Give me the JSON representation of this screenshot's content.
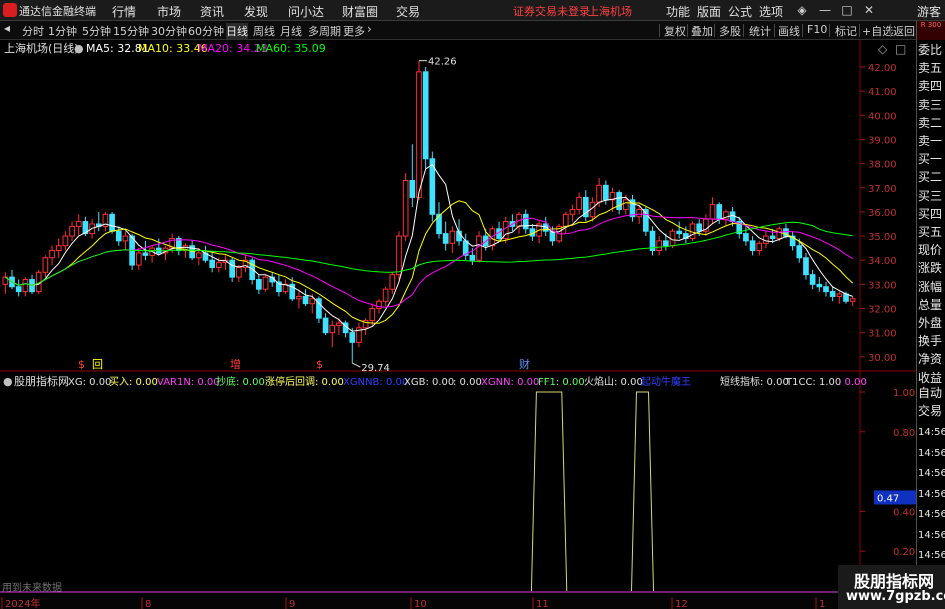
{
  "menubar": {
    "app_title": "通达信金融终端",
    "menus": [
      "行情",
      "市场",
      "资讯",
      "发现",
      "问小达",
      "财富圈",
      "交易"
    ],
    "warning": "证券交易未登录",
    "market": "上海机场",
    "right_menus": [
      "功能",
      "版面",
      "公式",
      "选项"
    ],
    "guest": "游客"
  },
  "toolbar": {
    "periods": [
      "分时",
      "1分钟",
      "5分钟",
      "15分钟",
      "30分钟",
      "60分钟",
      "日线",
      "周线",
      "月线",
      "多周期",
      "更多"
    ],
    "active_period": "日线",
    "tools": [
      "复权",
      "叠加",
      "多股",
      "统计",
      "画线",
      "F10",
      "标记",
      "+自选",
      "返回"
    ]
  },
  "corner_badge": "R 300",
  "main_chart": {
    "title": "上海机场(日线)",
    "ma": [
      {
        "label": "MA5: 32.81",
        "color": "#ffffff"
      },
      {
        "label": "MA10: 33.46",
        "color": "#ffff00"
      },
      {
        "label": "MA20: 34.23",
        "color": "#ff00ff"
      },
      {
        "label": "MA60: 35.09",
        "color": "#00ff00"
      }
    ],
    "y_ticks": [
      "42.00",
      "41.00",
      "40.00",
      "39.00",
      "38.00",
      "37.00",
      "36.00",
      "35.00",
      "34.00",
      "33.00",
      "32.00",
      "31.00",
      "30.00"
    ],
    "high_label": "42.26",
    "low_label": "29.74",
    "event_markers": [
      {
        "text": "$",
        "color": "#ff4040"
      },
      {
        "text": "回",
        "color": "#ffff00"
      },
      {
        "text": "增",
        "color": "#ff4040"
      },
      {
        "text": "$",
        "color": "#ff4040"
      },
      {
        "text": "财",
        "color": "#6090ff"
      }
    ]
  },
  "indicator": {
    "name": "股朋指标网",
    "items": [
      {
        "text": "XG: 0.00",
        "color": "#e0e0e0"
      },
      {
        "text": "买入: 0.00",
        "color": "#ffff60"
      },
      {
        "text": "VAR1N: 0.00",
        "color": "#ff40ff"
      },
      {
        "text": "抄底: 0.00",
        "color": "#60ff60"
      },
      {
        "text": "涨停后回调: 0.00",
        "color": "#ffff60"
      },
      {
        "text": "XGNNB: 0.00",
        "color": "#3040ff"
      },
      {
        "text": "XGB: 0.00",
        "color": "#e0e0e0"
      },
      {
        "text": ": 0.00",
        "color": "#e0e0e0"
      },
      {
        "text": "XGNN: 0.00",
        "color": "#ff40ff"
      },
      {
        "text": "FF1: 0.00",
        "color": "#60ff60"
      },
      {
        "text": "火焰山: 0.00",
        "color": "#e0e0e0"
      },
      {
        "text": "起动牛魔王",
        "color": "#3040ff"
      },
      {
        "text": "短线指标: 0.00",
        "color": "#e0e0e0"
      },
      {
        "text": "T1CC: 1.00",
        "color": "#e0e0e0"
      },
      {
        "text": ": 0.00",
        "color": "#ff40ff"
      }
    ],
    "y_ticks": [
      "1.00",
      "0.80",
      "0.47",
      "0.40",
      "0.20"
    ],
    "future_note": "用到未来数据"
  },
  "x_axis": [
    "2024年",
    "8",
    "9",
    "10",
    "11",
    "12",
    "1"
  ],
  "side_panel": {
    "tags": [
      "委比",
      "卖五",
      "卖四",
      "卖三",
      "卖二",
      "卖一",
      "买一",
      "买二",
      "买三",
      "买四",
      "买五",
      "现价",
      "涨跌",
      "涨幅",
      "总量",
      "外盘",
      "换手",
      "净资",
      "收益",
      "自动",
      "交易",
      "14:56",
      "14:56",
      "14:56",
      "14:56",
      "14:56",
      "14:56",
      "14:56",
      "14:56",
      "14:56"
    ]
  },
  "watermark": {
    "line1": "股朋指标网",
    "line2": "www.7gpzb.com"
  },
  "colors": {
    "up": "#ff3030",
    "down": "#40e0ff",
    "ma5": "#ffffff",
    "ma10": "#ffff00",
    "ma20": "#ff00ff",
    "ma60": "#00ff00",
    "sig_yellow": "#d8d870",
    "sig_magenta": "#e040e0",
    "grid": "#8b0000"
  },
  "candles": [
    [
      33.0,
      33.5,
      32.6,
      33.3
    ],
    [
      33.3,
      33.6,
      32.8,
      32.9
    ],
    [
      32.9,
      33.2,
      32.5,
      32.7
    ],
    [
      32.7,
      33.3,
      32.5,
      33.2
    ],
    [
      33.2,
      33.4,
      32.6,
      32.7
    ],
    [
      32.7,
      33.6,
      32.6,
      33.5
    ],
    [
      33.5,
      34.2,
      33.3,
      34.1
    ],
    [
      34.1,
      34.6,
      33.8,
      34.4
    ],
    [
      34.4,
      34.9,
      34.1,
      34.6
    ],
    [
      34.6,
      35.2,
      34.4,
      35.0
    ],
    [
      35.0,
      35.6,
      34.8,
      35.4
    ],
    [
      35.4,
      35.9,
      35.0,
      35.6
    ],
    [
      35.6,
      35.8,
      35.0,
      35.1
    ],
    [
      35.1,
      35.7,
      34.9,
      35.5
    ],
    [
      35.5,
      36.0,
      35.2,
      35.4
    ],
    [
      35.4,
      36.0,
      35.2,
      35.9
    ],
    [
      35.9,
      36.0,
      35.1,
      35.2
    ],
    [
      35.2,
      35.4,
      34.6,
      34.8
    ],
    [
      34.8,
      35.2,
      34.4,
      35.0
    ],
    [
      35.0,
      35.1,
      33.6,
      33.8
    ],
    [
      33.8,
      34.5,
      33.6,
      34.3
    ],
    [
      34.3,
      34.8,
      34.0,
      34.2
    ],
    [
      34.2,
      34.6,
      33.9,
      34.5
    ],
    [
      34.5,
      34.9,
      34.2,
      34.3
    ],
    [
      34.3,
      34.6,
      34.0,
      34.5
    ],
    [
      34.5,
      35.1,
      34.3,
      34.9
    ],
    [
      34.9,
      35.0,
      34.2,
      34.4
    ],
    [
      34.4,
      34.7,
      34.1,
      34.6
    ],
    [
      34.6,
      34.8,
      34.0,
      34.1
    ],
    [
      34.1,
      34.5,
      33.8,
      34.3
    ],
    [
      34.3,
      34.6,
      33.9,
      34.0
    ],
    [
      34.0,
      34.4,
      33.5,
      33.7
    ],
    [
      33.7,
      34.1,
      33.5,
      33.9
    ],
    [
      33.9,
      34.2,
      33.6,
      34.0
    ],
    [
      34.0,
      34.1,
      33.1,
      33.3
    ],
    [
      33.3,
      33.8,
      33.1,
      33.7
    ],
    [
      33.7,
      34.2,
      33.5,
      34.0
    ],
    [
      34.0,
      34.1,
      33.0,
      33.2
    ],
    [
      33.2,
      33.4,
      32.6,
      32.8
    ],
    [
      32.8,
      33.4,
      32.7,
      33.3
    ],
    [
      33.3,
      33.5,
      32.9,
      33.1
    ],
    [
      33.1,
      33.4,
      32.5,
      32.7
    ],
    [
      32.7,
      33.2,
      32.6,
      33.0
    ],
    [
      33.0,
      33.3,
      32.3,
      32.4
    ],
    [
      32.4,
      32.7,
      32.0,
      32.5
    ],
    [
      32.5,
      32.8,
      32.1,
      32.2
    ],
    [
      32.2,
      32.6,
      31.8,
      32.4
    ],
    [
      32.4,
      32.5,
      31.4,
      31.6
    ],
    [
      31.6,
      31.8,
      30.9,
      31.0
    ],
    [
      31.0,
      31.5,
      30.4,
      31.3
    ],
    [
      31.3,
      31.6,
      30.9,
      31.4
    ],
    [
      31.4,
      31.5,
      30.8,
      31.0
    ],
    [
      31.0,
      31.2,
      29.74,
      30.6
    ],
    [
      30.6,
      31.4,
      30.4,
      31.2
    ],
    [
      31.2,
      31.6,
      30.9,
      31.5
    ],
    [
      31.5,
      32.2,
      31.3,
      32.0
    ],
    [
      32.0,
      32.4,
      31.8,
      32.3
    ],
    [
      32.3,
      32.9,
      32.1,
      32.8
    ],
    [
      32.8,
      33.5,
      32.6,
      33.4
    ],
    [
      33.4,
      35.2,
      33.2,
      35.0
    ],
    [
      35.0,
      37.6,
      34.8,
      37.3
    ],
    [
      37.3,
      38.8,
      36.2,
      36.6
    ],
    [
      36.6,
      42.26,
      36.5,
      41.8
    ],
    [
      41.8,
      42.0,
      37.8,
      38.2
    ],
    [
      38.2,
      38.5,
      35.6,
      35.9
    ],
    [
      35.9,
      36.4,
      34.9,
      35.1
    ],
    [
      35.1,
      35.6,
      34.4,
      34.7
    ],
    [
      34.7,
      35.4,
      34.3,
      35.2
    ],
    [
      35.2,
      35.7,
      34.6,
      34.8
    ],
    [
      34.8,
      35.1,
      34.0,
      34.2
    ],
    [
      34.2,
      34.5,
      33.8,
      34.0
    ],
    [
      34.0,
      35.2,
      33.9,
      35.0
    ],
    [
      35.0,
      35.3,
      34.4,
      34.6
    ],
    [
      34.6,
      35.4,
      34.4,
      35.3
    ],
    [
      35.3,
      35.6,
      34.8,
      34.9
    ],
    [
      34.9,
      35.8,
      34.7,
      35.6
    ],
    [
      35.6,
      35.9,
      35.2,
      35.4
    ],
    [
      35.4,
      36.0,
      35.1,
      35.9
    ],
    [
      35.9,
      36.1,
      35.1,
      35.3
    ],
    [
      35.3,
      35.5,
      34.8,
      35.0
    ],
    [
      35.0,
      35.6,
      34.7,
      35.5
    ],
    [
      35.5,
      35.8,
      35.0,
      35.2
    ],
    [
      35.2,
      35.4,
      34.6,
      34.8
    ],
    [
      34.8,
      35.5,
      34.7,
      35.4
    ],
    [
      35.4,
      36.0,
      35.1,
      35.9
    ],
    [
      35.9,
      36.3,
      35.6,
      36.1
    ],
    [
      36.1,
      36.8,
      35.9,
      36.6
    ],
    [
      36.6,
      36.9,
      35.6,
      35.8
    ],
    [
      35.8,
      36.6,
      35.6,
      36.4
    ],
    [
      36.4,
      37.4,
      36.2,
      37.1
    ],
    [
      37.1,
      37.3,
      36.3,
      36.5
    ],
    [
      36.5,
      37.0,
      36.0,
      36.8
    ],
    [
      36.8,
      36.9,
      35.9,
      36.1
    ],
    [
      36.1,
      36.7,
      35.9,
      36.5
    ],
    [
      36.5,
      36.7,
      35.6,
      35.8
    ],
    [
      35.8,
      36.3,
      35.5,
      36.1
    ],
    [
      36.1,
      36.2,
      35.0,
      35.2
    ],
    [
      35.2,
      35.4,
      34.2,
      34.4
    ],
    [
      34.4,
      35.0,
      34.2,
      34.8
    ],
    [
      34.8,
      35.1,
      34.4,
      34.6
    ],
    [
      34.6,
      35.3,
      34.5,
      35.2
    ],
    [
      35.2,
      35.6,
      34.9,
      35.1
    ],
    [
      35.1,
      35.4,
      34.7,
      34.9
    ],
    [
      34.9,
      35.6,
      34.8,
      35.5
    ],
    [
      35.5,
      35.7,
      35.0,
      35.2
    ],
    [
      35.2,
      35.9,
      35.0,
      35.7
    ],
    [
      35.7,
      36.6,
      35.5,
      36.3
    ],
    [
      36.3,
      36.4,
      35.5,
      35.7
    ],
    [
      35.7,
      36.1,
      35.4,
      36.0
    ],
    [
      36.0,
      36.2,
      35.4,
      35.6
    ],
    [
      35.6,
      35.8,
      34.9,
      35.1
    ],
    [
      35.1,
      35.4,
      34.6,
      34.8
    ],
    [
      34.8,
      35.0,
      34.2,
      34.4
    ],
    [
      34.4,
      34.8,
      34.2,
      34.7
    ],
    [
      34.7,
      35.2,
      34.5,
      35.0
    ],
    [
      35.0,
      35.3,
      34.7,
      34.9
    ],
    [
      34.9,
      35.4,
      34.8,
      35.3
    ],
    [
      35.3,
      35.5,
      34.9,
      35.0
    ],
    [
      35.0,
      35.2,
      34.4,
      34.6
    ],
    [
      34.6,
      34.9,
      33.9,
      34.1
    ],
    [
      34.1,
      34.3,
      33.2,
      33.4
    ],
    [
      33.4,
      33.6,
      32.8,
      33.0
    ],
    [
      33.0,
      33.3,
      32.7,
      32.9
    ],
    [
      32.9,
      33.1,
      32.5,
      32.7
    ],
    [
      32.7,
      32.9,
      32.3,
      32.5
    ],
    [
      32.5,
      32.7,
      32.2,
      32.6
    ],
    [
      32.6,
      32.7,
      32.2,
      32.3
    ],
    [
      32.3,
      32.5,
      32.1,
      32.4
    ]
  ],
  "signal_pulses": [
    {
      "start": 79,
      "end": 84,
      "color": "yellow"
    },
    {
      "start": 94,
      "end": 97,
      "color": "yellow"
    },
    {
      "start": 172,
      "end": 174,
      "color": "magenta"
    },
    {
      "start": 207,
      "end": 212,
      "color": "yellow"
    }
  ]
}
